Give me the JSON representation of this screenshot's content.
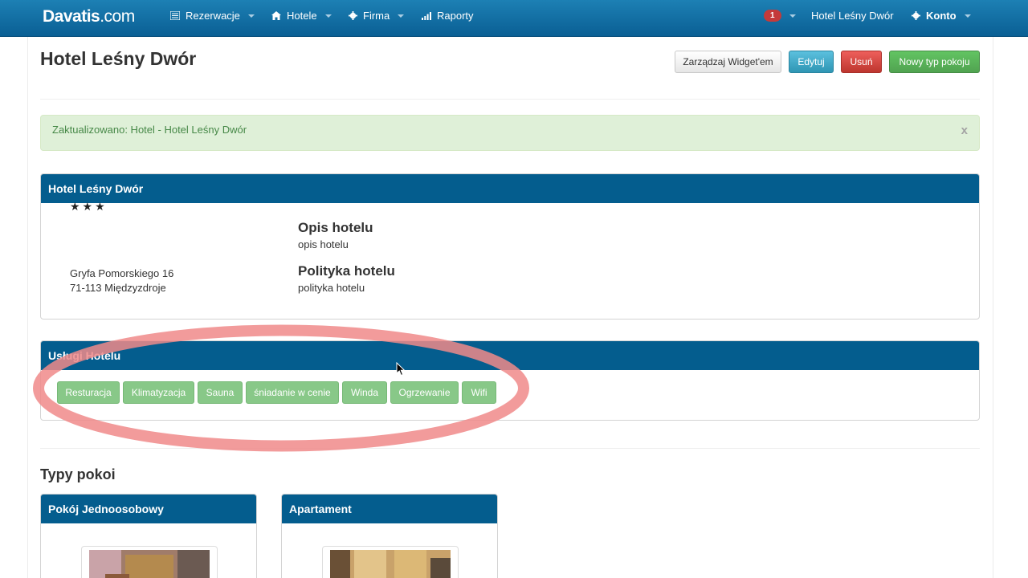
{
  "navbar": {
    "brand_bold": "Davatis",
    "brand_rest": ".com",
    "menu": [
      {
        "label": "Rezerwacje",
        "icon": "list-icon"
      },
      {
        "label": "Hotele",
        "icon": "home-icon"
      },
      {
        "label": "Firma",
        "icon": "gear-icon"
      },
      {
        "label": "Raporty",
        "icon": "signal-icon"
      }
    ],
    "notifications_count": "1",
    "current_hotel": "Hotel Leśny Dwór",
    "account": "Konto"
  },
  "header": {
    "title": "Hotel Leśny Dwór",
    "buttons": {
      "widget": "Zarządzaj Widget'em",
      "edit": "Edytuj",
      "delete": "Usuń",
      "new_room_type": "Nowy typ pokoju"
    }
  },
  "alert": {
    "text": "Zaktualizowano: Hotel - Hotel Leśny Dwór",
    "close": "x"
  },
  "hotel_panel": {
    "heading": "Hotel Leśny Dwór",
    "stars": "★★★",
    "star_rating": 3,
    "address_line1": "Gryfa Pomorskiego 16",
    "address_line2": "71-113 Międzyzdroje",
    "description_title": "Opis hotelu",
    "description": "opis hotelu",
    "policy_title": "Polityka hotelu",
    "policy": "polityka hotelu"
  },
  "services_panel": {
    "heading": "Usługi Hotelu",
    "tags": [
      "Resturacja",
      "Klimatyzacja",
      "Sauna",
      "śniadanie w cenie",
      "Winda",
      "Ogrzewanie",
      "Wifi"
    ]
  },
  "room_types": {
    "heading": "Typy pokoi",
    "rooms": [
      {
        "name": "Pokój Jednoosobowy"
      },
      {
        "name": "Apartament"
      }
    ]
  },
  "colors": {
    "navbar": "#0a5f94",
    "panel_header": "#045d8e",
    "alert_bg": "#dff0d8",
    "alert_text": "#468847",
    "tag_bg": "#88c888",
    "annotation": "#f08a8a"
  }
}
